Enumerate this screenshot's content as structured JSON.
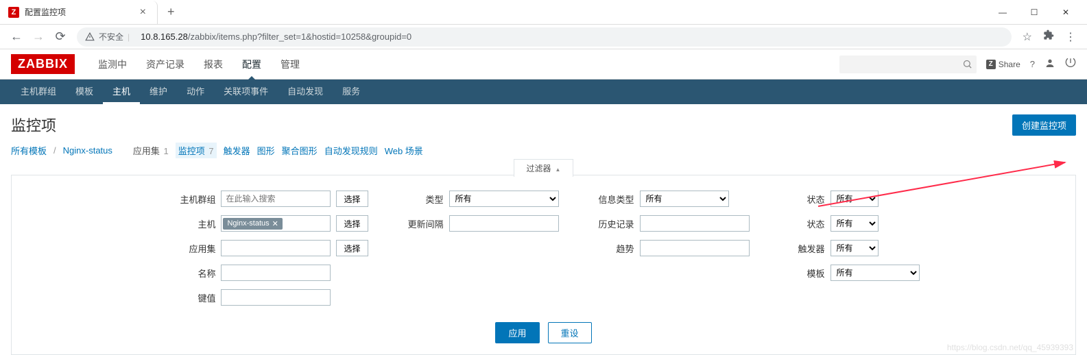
{
  "browser": {
    "tab_title": "配置监控项",
    "insecure_label": "不安全",
    "url_host": "10.8.165.28",
    "url_path": "/zabbix/items.php?filter_set=1&hostid=10258&groupid=0"
  },
  "header": {
    "logo": "ZABBIX",
    "nav": [
      "监测中",
      "资产记录",
      "报表",
      "配置",
      "管理"
    ],
    "nav_active": 3,
    "share_label": "Share"
  },
  "subnav": {
    "items": [
      "主机群组",
      "模板",
      "主机",
      "维护",
      "动作",
      "关联项事件",
      "自动发现",
      "服务"
    ],
    "active": 2
  },
  "page": {
    "title": "监控项",
    "create_btn": "创建监控项"
  },
  "crumbs": [
    {
      "label": "所有模板",
      "link": true
    },
    {
      "label": "Nginx-status",
      "link": true
    },
    {
      "label": "应用集",
      "count": "1",
      "link": false
    },
    {
      "label": "监控项",
      "count": "7",
      "link": true,
      "selected": true
    },
    {
      "label": "触发器",
      "link": true
    },
    {
      "label": "图形",
      "link": true
    },
    {
      "label": "聚合图形",
      "link": true
    },
    {
      "label": "自动发现规则",
      "link": true
    },
    {
      "label": "Web 场景",
      "link": true
    }
  ],
  "filter": {
    "toggle_label": "过滤器",
    "col1": {
      "host_group": {
        "label": "主机群组",
        "placeholder": "在此输入搜索",
        "pick": "选择"
      },
      "host": {
        "label": "主机",
        "tag": "Nginx-status",
        "pick": "选择"
      },
      "app": {
        "label": "应用集",
        "pick": "选择"
      },
      "name": {
        "label": "名称"
      },
      "key": {
        "label": "键值"
      }
    },
    "col2": {
      "type": {
        "label": "类型",
        "value": "所有"
      },
      "interval": {
        "label": "更新间隔"
      }
    },
    "col3": {
      "info_type": {
        "label": "信息类型",
        "value": "所有"
      },
      "history": {
        "label": "历史记录"
      },
      "trends": {
        "label": "趋势"
      }
    },
    "col4": {
      "status": {
        "label": "状态",
        "value": "所有"
      },
      "state": {
        "label": "状态",
        "value": "所有"
      },
      "triggers": {
        "label": "触发器",
        "value": "所有"
      },
      "template": {
        "label": "模板",
        "value": "所有"
      }
    },
    "apply": "应用",
    "reset": "重设"
  },
  "watermark": "https://blog.csdn.net/qq_45939393"
}
